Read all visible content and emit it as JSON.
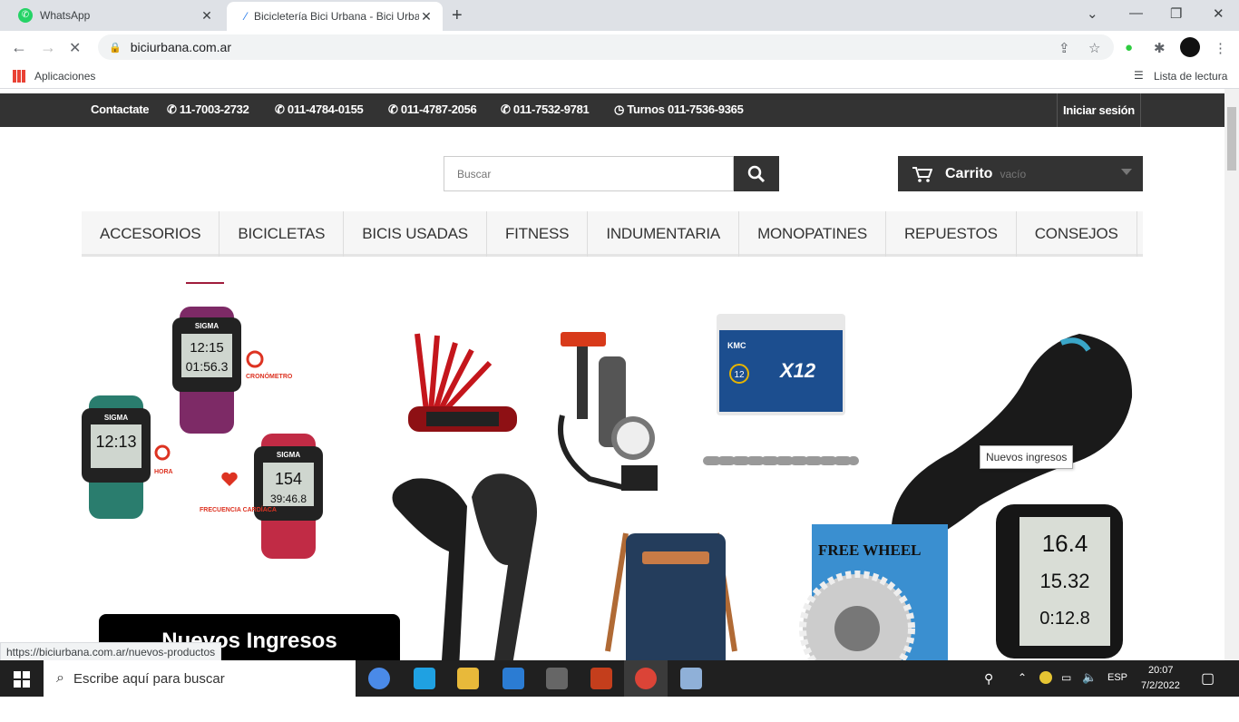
{
  "browser": {
    "tabs": [
      {
        "title": "WhatsApp"
      },
      {
        "title": "Bicicletería Bici Urbana - Bici Urba"
      }
    ],
    "url": "biciurbana.com.ar",
    "bookmarks": {
      "apps": "Aplicaciones",
      "reading_list": "Lista de lectura"
    },
    "status_url": "https://biciurbana.com.ar/nuevos-productos"
  },
  "topbar": {
    "contact": "Contactate",
    "phones": [
      "11-7003-2732",
      "011-4784-0155",
      "011-4787-2056",
      "011-7532-9781",
      "Turnos 011-7536-9365"
    ],
    "login": "Iniciar sesión"
  },
  "search": {
    "placeholder": "Buscar"
  },
  "cart": {
    "label": "Carrito",
    "status": "vacío"
  },
  "menu": [
    "ACCESORIOS",
    "BICICLETAS",
    "BICIS USADAS",
    "FITNESS",
    "INDUMENTARIA",
    "MONOPATINES",
    "REPUESTOS",
    "CONSEJOS"
  ],
  "banner": {
    "promo": "Nuevos Ingresos",
    "tooltip": "Nuevos ingresos",
    "watch_labels": {
      "brand": "SIGMA",
      "crono": "CRONÓMETRO",
      "hora": "HORA",
      "frec": "FRECUENCIA CARDÍACA",
      "w1a": "12:15",
      "w1b": "01:56.3",
      "w2": "12:13",
      "w3a": "154",
      "w3b": "39:46.8"
    },
    "chain_labels": {
      "brand": "KMC",
      "model": "X12",
      "speed": "12"
    },
    "freewheel_label": "FREE WHEEL",
    "computer_labels": [
      "16.4",
      "15.32",
      "0:12.8"
    ]
  },
  "taskbar": {
    "search": "Escribe aquí para buscar",
    "lang": "ESP",
    "time": "20:07",
    "date": "7/2/2022"
  }
}
